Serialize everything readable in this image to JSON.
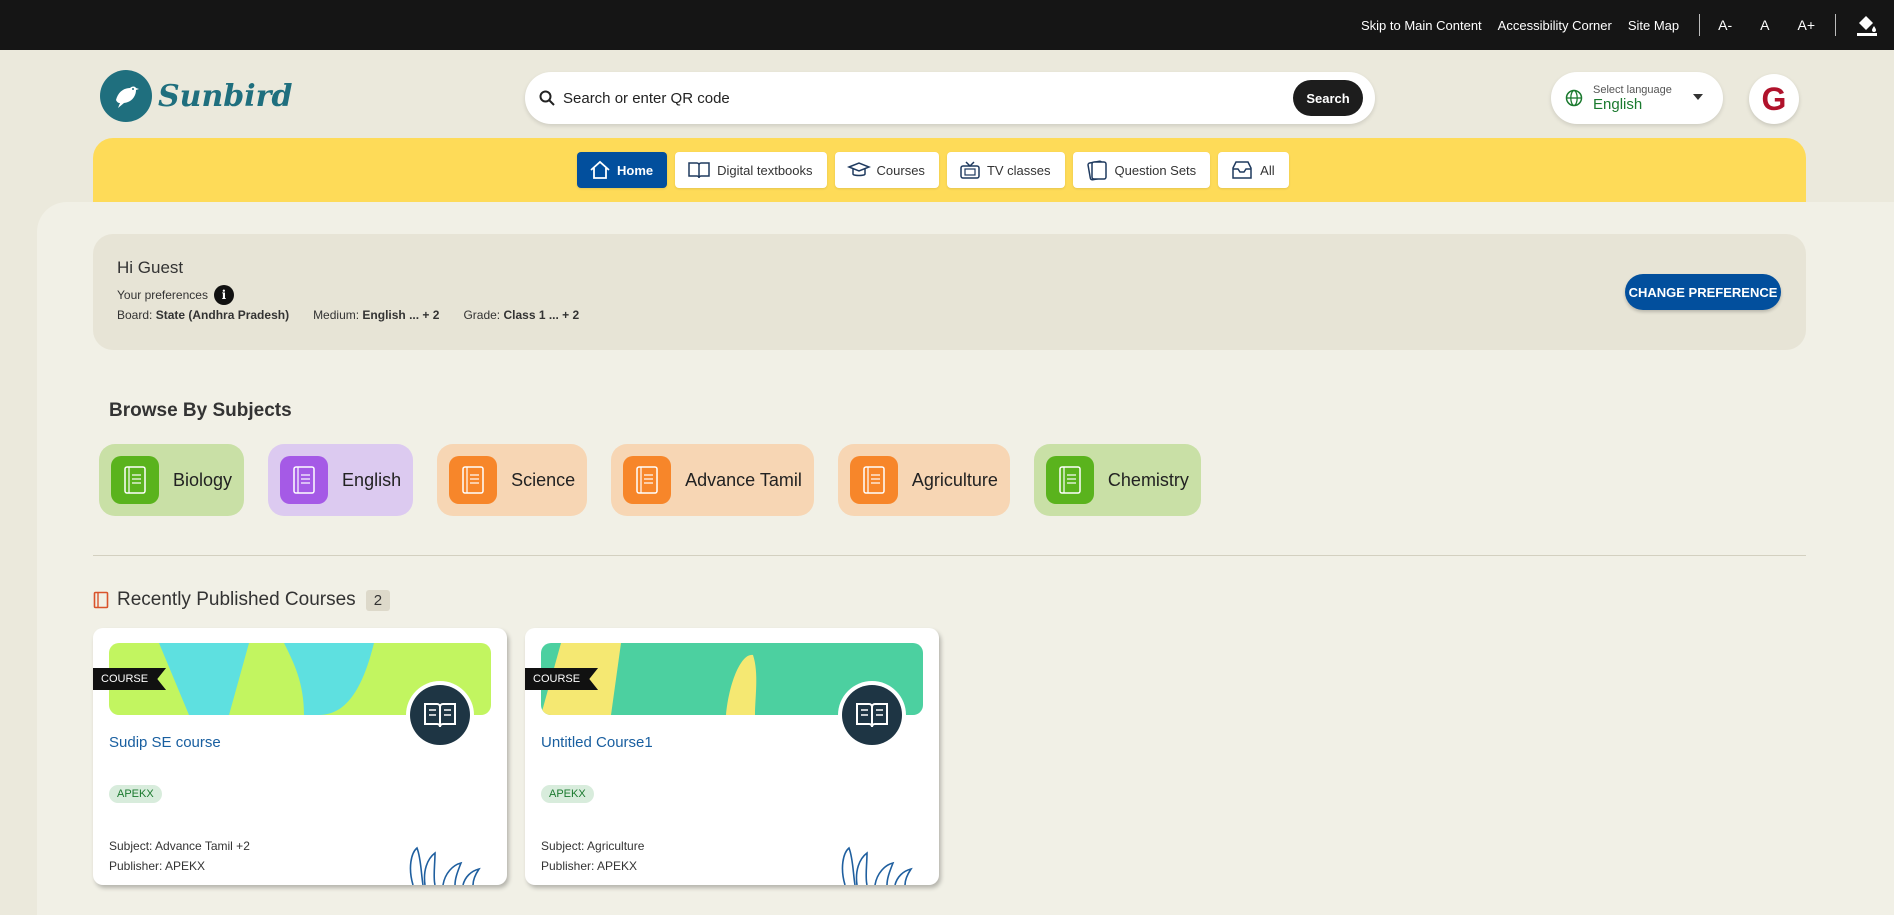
{
  "topbar": {
    "skip": "Skip to Main Content",
    "accessibility": "Accessibility Corner",
    "sitemap": "Site Map",
    "font_decrease": "A-",
    "font_normal": "A",
    "font_increase": "A+"
  },
  "header": {
    "logo_text": "Sunbird",
    "search_placeholder": "Search or enter QR code",
    "search_button": "Search",
    "language_label": "Select language",
    "language_value": "English",
    "avatar_initial": "G"
  },
  "nav": {
    "tabs": [
      {
        "label": "Home",
        "icon": "home-icon",
        "active": true
      },
      {
        "label": "Digital textbooks",
        "icon": "book-icon"
      },
      {
        "label": "Courses",
        "icon": "graduation-cap-icon"
      },
      {
        "label": "TV classes",
        "icon": "tv-icon"
      },
      {
        "label": "Question Sets",
        "icon": "question-set-icon"
      },
      {
        "label": "All",
        "icon": "inbox-icon"
      }
    ]
  },
  "preferences": {
    "greeting": "Hi Guest",
    "your_prefs": "Your preferences",
    "board_label": "Board:",
    "board_value": "State (Andhra Pradesh)",
    "medium_label": "Medium:",
    "medium_value": "English ... + 2",
    "grade_label": "Grade:",
    "grade_value": "Class 1 ... + 2",
    "change_button": "CHANGE PREFERENCE"
  },
  "browse": {
    "title": "Browse By Subjects",
    "subjects": [
      {
        "label": "Biology",
        "color": "#5ab31d"
      },
      {
        "label": "English",
        "color": "#a55ae6"
      },
      {
        "label": "Science",
        "color": "#f7862a"
      },
      {
        "label": "Advance Tamil",
        "color": "#f7862a"
      },
      {
        "label": "Agriculture",
        "color": "#f7862a"
      },
      {
        "label": "Chemistry",
        "color": "#5ab31d"
      }
    ]
  },
  "recent": {
    "title": "Recently Published Courses",
    "count": "2",
    "cards": [
      {
        "badge": "COURSE",
        "title": "Sudip SE course",
        "tag": "APEKX",
        "subject": "Subject: Advance Tamil +2",
        "publisher": "Publisher: APEKX"
      },
      {
        "badge": "COURSE",
        "title": "Untitled Course1",
        "tag": "APEKX",
        "subject": "Subject: Agriculture",
        "publisher": "Publisher: APEKX"
      }
    ]
  }
}
